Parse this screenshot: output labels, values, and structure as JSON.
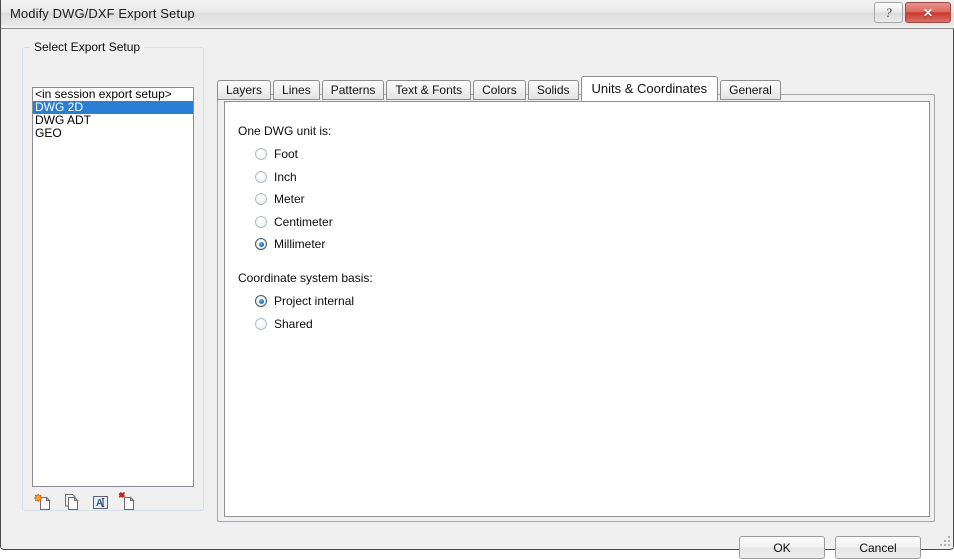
{
  "window": {
    "title": "Modify DWG/DXF Export Setup",
    "help_label": "?",
    "close_label": "✕",
    "accent_selection": "#2a7fd4",
    "close_button_color": "#c9382c"
  },
  "left_panel": {
    "groupbox_title": "Select Export Setup",
    "list_items": [
      {
        "label": "<in session export setup>",
        "selected": false
      },
      {
        "label": "DWG 2D",
        "selected": true
      },
      {
        "label": "DWG ADT",
        "selected": false
      },
      {
        "label": "GEO",
        "selected": false
      }
    ],
    "toolbar": [
      {
        "name": "new-export-setup-icon",
        "tooltip": "New"
      },
      {
        "name": "duplicate-export-setup-icon",
        "tooltip": "Duplicate"
      },
      {
        "name": "rename-export-setup-icon",
        "tooltip": "Rename"
      },
      {
        "name": "delete-export-setup-icon",
        "tooltip": "Delete"
      }
    ]
  },
  "tabs": [
    {
      "label": "Layers",
      "active": false
    },
    {
      "label": "Lines",
      "active": false
    },
    {
      "label": "Patterns",
      "active": false
    },
    {
      "label": "Text & Fonts",
      "active": false
    },
    {
      "label": "Colors",
      "active": false
    },
    {
      "label": "Solids",
      "active": false
    },
    {
      "label": "Units & Coordinates",
      "active": true
    },
    {
      "label": "General",
      "active": false
    }
  ],
  "units_panel": {
    "unit_group_label": "One DWG unit is:",
    "unit_options": [
      {
        "label": "Foot",
        "checked": false
      },
      {
        "label": "Inch",
        "checked": false
      },
      {
        "label": "Meter",
        "checked": false
      },
      {
        "label": "Centimeter",
        "checked": false
      },
      {
        "label": "Millimeter",
        "checked": true
      }
    ],
    "coordinate_group_label": "Coordinate system basis:",
    "coordinate_options": [
      {
        "label": "Project internal",
        "checked": true
      },
      {
        "label": "Shared",
        "checked": false
      }
    ]
  },
  "footer": {
    "ok_label": "OK",
    "cancel_label": "Cancel"
  }
}
